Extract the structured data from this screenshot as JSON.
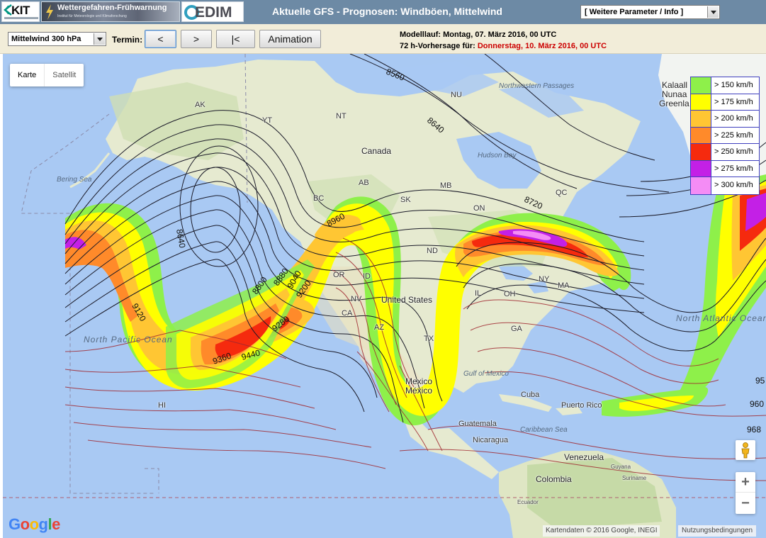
{
  "header": {
    "logo_kit": "KIT",
    "logo_warn_title": "Wettergefahren-Frühwarnung",
    "logo_warn_sub": "Institut für Meteorologie und Klimaforschung",
    "logo_cedim": "EDIM",
    "title": "Aktuelle GFS - Prognosen: Windböen, Mittelwind",
    "param_select": "[ Weitere Parameter / Info ]",
    "background_color": "#6d8aa5"
  },
  "toolbar": {
    "level_select": "Mittelwind 300 hPa",
    "termin_label": "Termin:",
    "btn_prev": "<",
    "btn_next": ">",
    "btn_first": "|<",
    "btn_animation": "Animation",
    "model_run": "Modelllauf: Montag, 07. März 2016, 00 UTC",
    "forecast_prefix": "72 h-Vorhersage für:",
    "forecast_date": "Donnerstag, 10. März 2016, 00 UTC",
    "background_color": "#f2edd9"
  },
  "map": {
    "toggle_map": "Karte",
    "toggle_sat": "Satellit",
    "zoom_in": "+",
    "zoom_out": "−",
    "google": [
      "G",
      "o",
      "o",
      "g",
      "l",
      "e"
    ],
    "google_colors": [
      "#4285f4",
      "#ea4335",
      "#fbbc05",
      "#4285f4",
      "#34a853",
      "#ea4335"
    ],
    "attribution": "Kartendaten © 2016 Google, INEGI",
    "terms": "Nutzungsbedingungen",
    "ocean_color": "#a9c9f3",
    "labels": {
      "canada": "Canada",
      "nunavut": "NU",
      "nwt": "NT",
      "yukon": "YT",
      "alaska": "AK",
      "bc": "BC",
      "ab": "AB",
      "sk": "SK",
      "mb": "MB",
      "on": "ON",
      "qc": "QC",
      "nd": "ND",
      "or": "OR",
      "id": "ID",
      "nv": "NV",
      "ca": "CA",
      "az": "AZ",
      "tx": "TX",
      "il": "IL",
      "oh": "OH",
      "ny": "NY",
      "ga": "GA",
      "ma": "MA",
      "united_states": "United States",
      "mexico": "Mexico",
      "mexico2": "México",
      "cuba": "Cuba",
      "puerto_rico": "Puerto Rico",
      "guatemala": "Guatemala",
      "nicaragua": "Nicaragua",
      "venezuela": "Venezuela",
      "colombia": "Colombia",
      "guyana": "Guyana",
      "suriname": "Suriname",
      "ecuador": "Ecuador",
      "kalaallit": "Kalaall",
      "nunaat": "Nunaa",
      "greenland": "Greenla",
      "hi": "HI",
      "northwestern_passages": "Northwestern Passages",
      "hudson_bay": "Hudson Bay",
      "bering_sea": "Bering Sea",
      "gulf_of_mexico": "Gulf of Mexico",
      "caribbean_sea": "Caribbean Sea",
      "north_pacific_ocean": "North Pacific Ocean",
      "north_atlantic_ocean": "North Atlantic Ocean"
    },
    "contour_labels": [
      "8560",
      "8640",
      "8720",
      "8640",
      "8800",
      "8880",
      "8960",
      "9040",
      "9120",
      "9200",
      "9280",
      "9360",
      "9440",
      "95",
      "960",
      "968"
    ]
  },
  "legend": [
    {
      "label": "> 150 km/h",
      "color": "#8ef04a"
    },
    {
      "label": "> 175 km/h",
      "color": "#ffff00"
    },
    {
      "label": "> 200 km/h",
      "color": "#ffc633"
    },
    {
      "label": "> 225 km/h",
      "color": "#ff8a2a"
    },
    {
      "label": "> 250 km/h",
      "color": "#f52a0e"
    },
    {
      "label": "> 275 km/h",
      "color": "#c320e6"
    },
    {
      "label": "> 300 km/h",
      "color": "#f48cf5"
    }
  ]
}
